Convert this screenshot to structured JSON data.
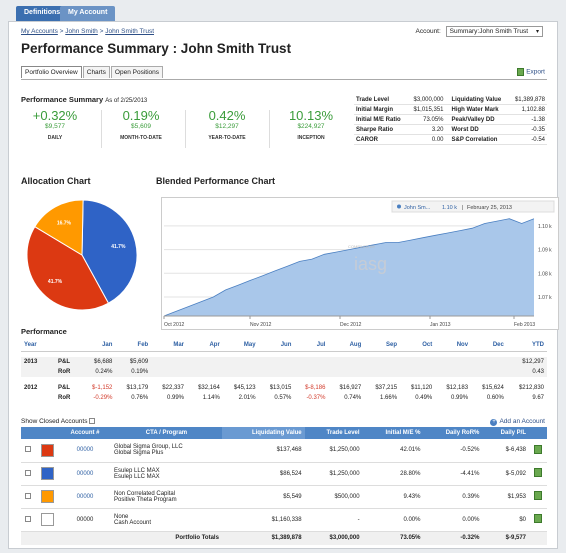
{
  "topnav": {
    "tabs": [
      "Definitions",
      "My Account"
    ]
  },
  "breadcrumb": [
    "My Accounts",
    "John Smith",
    "John Smith Trust"
  ],
  "account_selector": {
    "label": "Account:",
    "value": "Summary:John Smith Trust"
  },
  "page_title": "Performance Summary : John Smith Trust",
  "tabs": [
    "Portfolio Overview",
    "Charts",
    "Open Positions"
  ],
  "export_label": "Export",
  "perf_summary": {
    "title": "Performance Summary",
    "as_of": "As of 2/25/2013",
    "metrics": [
      {
        "big": "+0.32%",
        "sub": "$9,577",
        "label": "DAILY"
      },
      {
        "big": "0.19%",
        "sub": "$5,609",
        "label": "MONTH-TO-DATE"
      },
      {
        "big": "0.42%",
        "sub": "$12,297",
        "label": "YEAR-TO-DATE"
      },
      {
        "big": "10.13%",
        "sub": "$224,927",
        "label": "INCEPTION"
      }
    ]
  },
  "stats": [
    [
      "Trade Level",
      "$3,000,000",
      "Liquidating Value",
      "$1,389,878"
    ],
    [
      "Initial Margin",
      "$1,015,351",
      "High Water Mark",
      "1,102.88"
    ],
    [
      "Initial M/E Ratio",
      "73.05%",
      "Peak/Valley DD",
      "-1.38"
    ],
    [
      "Sharpe Ratio",
      "3.20",
      "Worst DD",
      "-0.35"
    ],
    [
      "CAROR",
      "0.00",
      "S&P Correlation",
      "-0.54"
    ]
  ],
  "allocation": {
    "title": "Allocation Chart",
    "slices": [
      {
        "label": "41.7%",
        "value": 41.7,
        "color": "#2f63c6"
      },
      {
        "label": "41.7%",
        "value": 41.6,
        "color": "#dc3912"
      },
      {
        "label": "16.7%",
        "value": 16.7,
        "color": "#ff9900"
      }
    ]
  },
  "blended": {
    "title": "Blended Performance Chart",
    "legend_name": "John Sm...",
    "legend_value": "1.10 k",
    "legend_date": "February 25, 2013",
    "watermark_small": "COMPILED BY",
    "watermark": "iasg"
  },
  "chart_data": {
    "type": "area",
    "x": [
      "Oct 2012",
      "Nov 2012",
      "Dec 2012",
      "Jan 2013",
      "Feb 2013"
    ],
    "xticks": [
      "Oct 2012",
      "Nov 2012",
      "Dec 2012",
      "Jan 2013",
      "Feb 2013"
    ],
    "yticks": [
      "1.07 k",
      "1.08 k",
      "1.09 k",
      "1.10 k"
    ],
    "ylim": [
      1062,
      1105
    ],
    "series": [
      {
        "name": "John Sm...",
        "values": [
          1062,
          1064,
          1066,
          1068,
          1070,
          1073,
          1075,
          1077,
          1079,
          1081,
          1083,
          1085,
          1086,
          1088,
          1089,
          1090,
          1091,
          1092,
          1093,
          1093,
          1094,
          1095,
          1096,
          1097,
          1098,
          1099,
          1101,
          1102,
          1103,
          1101,
          1103
        ]
      }
    ]
  },
  "performance": {
    "title": "Performance",
    "headers": [
      "Year",
      "Jan",
      "Feb",
      "Mar",
      "Apr",
      "May",
      "Jun",
      "Jul",
      "Aug",
      "Sep",
      "Oct",
      "Nov",
      "Dec",
      "YTD"
    ],
    "years": [
      {
        "year": "2013",
        "rows": [
          {
            "label": "P&L",
            "values": [
              "$6,688",
              "$5,609",
              "",
              "",
              "",
              "",
              "",
              "",
              "",
              "",
              "",
              "",
              "$12,297"
            ]
          },
          {
            "label": "RoR",
            "values": [
              "0.24%",
              "0.19%",
              "",
              "",
              "",
              "",
              "",
              "",
              "",
              "",
              "",
              "",
              "0.43"
            ]
          }
        ]
      },
      {
        "year": "2012",
        "rows": [
          {
            "label": "P&L",
            "values": [
              "$-1,152",
              "$13,179",
              "$22,337",
              "$32,164",
              "$45,123",
              "$13,015",
              "$-8,186",
              "$16,927",
              "$37,215",
              "$11,120",
              "$12,183",
              "$15,624",
              "$212,830"
            ]
          },
          {
            "label": "RoR",
            "values": [
              "-0.29%",
              "0.76%",
              "0.99%",
              "1.14%",
              "2.01%",
              "0.57%",
              "-0.37%",
              "0.74%",
              "1.66%",
              "0.49%",
              "0.99%",
              "0.60%",
              "9.67"
            ]
          }
        ]
      }
    ]
  },
  "show_closed_label": "Show Closed Accounts",
  "add_account_label": "Add an Account",
  "accounts": {
    "headers": [
      "",
      "",
      "Account #",
      "CTA / Program",
      "Liquidating Value",
      "Trade Level",
      "Initial M/E %",
      "Daily RoR%",
      "Daily P/L",
      ""
    ],
    "rows": [
      {
        "color": "#dc3912",
        "acct": "00000",
        "cta1": "Global Sigma Group, LLC",
        "cta2": "Global Sigma Plus",
        "liq": "$137,468",
        "trade": "$1,250,000",
        "me": "42.01%",
        "ror": "-0.52%",
        "pl": "$-6,438"
      },
      {
        "color": "#2f63c6",
        "acct": "00000",
        "cta1": "Esulep LLC MAX",
        "cta2": "Esulep LLC MAX",
        "liq": "$86,524",
        "trade": "$1,250,000",
        "me": "28.80%",
        "ror": "-4.41%",
        "pl": "$-5,092"
      },
      {
        "color": "#ff9900",
        "acct": "00000",
        "cta1": "Non Correlated Capital",
        "cta2": "Positive Theta Program",
        "liq": "$5,549",
        "trade": "$500,000",
        "me": "9.43%",
        "ror": "0.39%",
        "pl": "$1,953"
      },
      {
        "color": "#ffffff",
        "acct": "00000",
        "cta1": "None",
        "cta2": "Cash Account",
        "liq": "$1,160,338",
        "trade": "-",
        "me": "0.00%",
        "ror": "0.00%",
        "pl": "$0"
      }
    ],
    "totals": {
      "label": "Portfolio Totals",
      "liq": "$1,389,878",
      "trade": "$3,000,000",
      "me": "73.05%",
      "ror": "-0.32%",
      "pl": "$-9,577"
    }
  }
}
